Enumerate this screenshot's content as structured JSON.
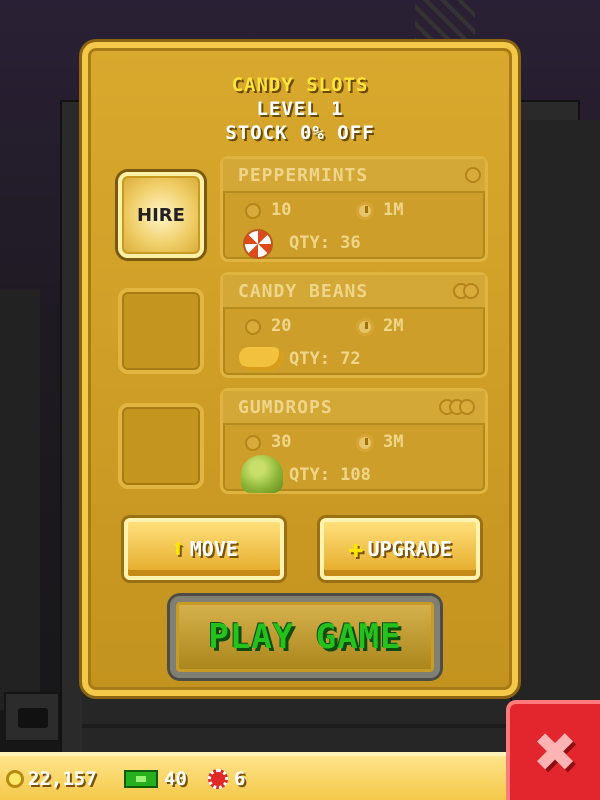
{
  "panel": {
    "title": "CANDY SLOTS",
    "level": "LEVEL 1",
    "stock": "STOCK 0% OFF"
  },
  "slots": [
    {
      "label": "HIRE"
    },
    {
      "label": ""
    },
    {
      "label": ""
    }
  ],
  "items": [
    {
      "name": "PEPPERMINTS",
      "cost": "10",
      "time": "1M",
      "qty": "QTY: 36",
      "icon": "peppermint-icon"
    },
    {
      "name": "CANDY BEANS",
      "cost": "20",
      "time": "2M",
      "qty": "QTY: 72",
      "icon": "candy-beans-icon"
    },
    {
      "name": "GUMDROPS",
      "cost": "30",
      "time": "3M",
      "qty": "QTY: 108",
      "icon": "gumdrop-icon"
    }
  ],
  "buttons": {
    "move": "MOVE",
    "upgrade": "UPGRADE",
    "play": "PLAY GAME",
    "close": "✖"
  },
  "status": {
    "coins": "22,157",
    "bux": "40",
    "gems": "6"
  },
  "colors": {
    "panel": "#d9a92e",
    "accent": "#ffe23a",
    "play_text": "#25c11d",
    "close": "#e3262d"
  }
}
